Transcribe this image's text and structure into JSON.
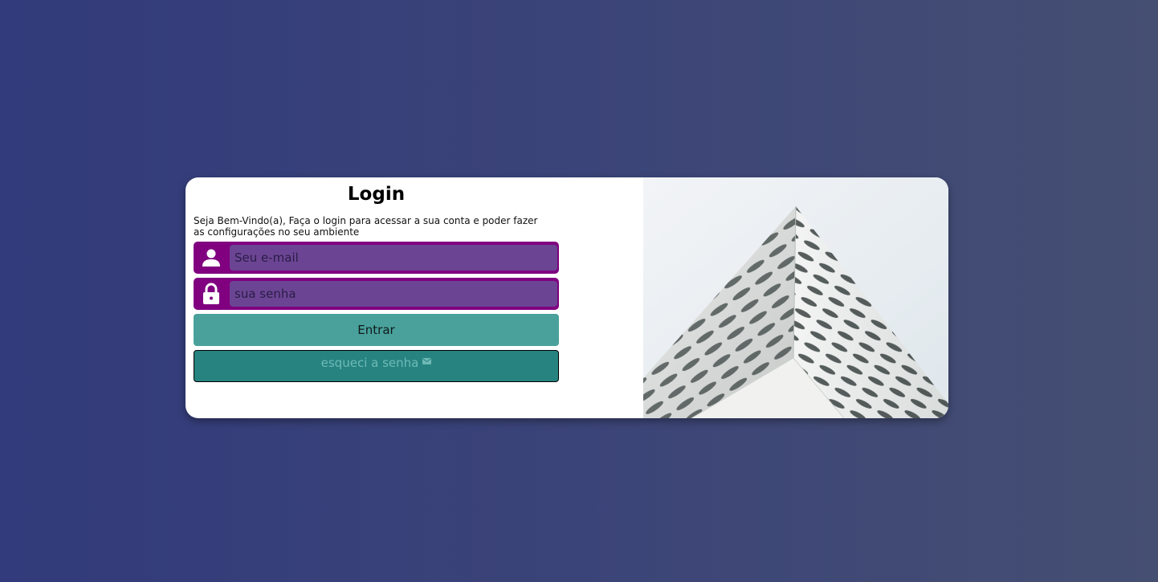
{
  "login": {
    "title": "Login",
    "subtitle": "Seja Bem-Vindo(a), Faça o login para acessar a sua conta e poder fazer as configurações no seu ambiente",
    "email_placeholder": "Seu e-mail",
    "email_value": "",
    "password_placeholder": "sua senha",
    "password_value": "",
    "submit_label": "Entrar",
    "forgot_label": "esqueci a senha"
  },
  "icons": {
    "email": "user-icon",
    "password": "lock-icon",
    "forgot": "mail-icon"
  },
  "colors": {
    "field_bg": "#800080",
    "input_bg": "#6b4593",
    "enter_button": "#4aa19c",
    "forgot_button": "#268380"
  }
}
